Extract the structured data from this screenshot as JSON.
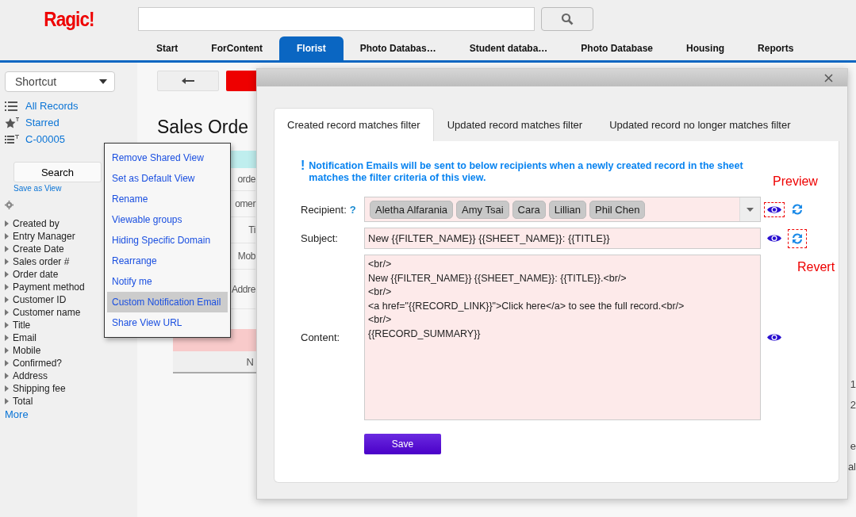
{
  "logo": "Ragic!",
  "tabs": [
    {
      "label": "Start",
      "selected": false
    },
    {
      "label": "ForContent",
      "selected": false
    },
    {
      "label": "Florist",
      "selected": true
    },
    {
      "label": "Photo Databas…",
      "selected": false
    },
    {
      "label": "Student databa…",
      "selected": false
    },
    {
      "label": "Photo Database",
      "selected": false
    },
    {
      "label": "Housing",
      "selected": false
    },
    {
      "label": "Reports",
      "selected": false
    }
  ],
  "sidebar": {
    "shortcut": "Shortcut",
    "views": [
      {
        "label": "All Records",
        "kind": "list"
      },
      {
        "label": "Starred",
        "kind": "star"
      },
      {
        "label": "C-00005",
        "kind": "filter"
      }
    ],
    "search_button": "Search",
    "save_view": "Save as View",
    "fields": [
      "Created by",
      "Entry Manager",
      "Create Date",
      "Sales order #",
      "Order date",
      "Payment method",
      "Customer ID",
      "Customer name",
      "Title",
      "Email",
      "Mobile",
      "Confirmed?",
      "Address",
      "Shipping fee",
      "Total"
    ],
    "more": "More"
  },
  "background": {
    "title": "Sales Orde",
    "field_labels": [
      "orde",
      "omer",
      "Ti",
      "Mob",
      "Addre"
    ],
    "table_header": "N",
    "row_numbers": [
      "1",
      "2"
    ],
    "footer_fragments": [
      "e",
      "al"
    ]
  },
  "context_menu": {
    "items": [
      {
        "label": "Remove Shared View",
        "selected": false
      },
      {
        "label": "Set as Default View",
        "selected": false
      },
      {
        "label": "Rename",
        "selected": false
      },
      {
        "label": "Viewable groups",
        "selected": false
      },
      {
        "label": "Hiding Specific Domain",
        "selected": false
      },
      {
        "label": "Rearrange",
        "selected": false
      },
      {
        "label": "Notify me",
        "selected": false
      },
      {
        "label": "Custom Notification Email",
        "selected": true
      },
      {
        "label": "Share View URL",
        "selected": false
      }
    ]
  },
  "dialog": {
    "tabs": [
      {
        "label": "Created record matches filter",
        "selected": true
      },
      {
        "label": "Updated record matches filter",
        "selected": false
      },
      {
        "label": "Updated record no longer matches filter",
        "selected": false
      }
    ],
    "notice_mark": "!",
    "notice": "Notification Emails will be sent to below recipients when a newly created record in the sheet matches the filter criteria of this view.",
    "recipient_label": "Recipient:",
    "help": "?",
    "recipients": [
      "Aletha Alfarania",
      "Amy Tsai",
      "Cara",
      "Lillian",
      "Phil Chen"
    ],
    "subject_label": "Subject:",
    "subject": "New {{FILTER_NAME}} {{SHEET_NAME}}: {{TITLE}}",
    "content_label": "Content:",
    "content_lines": [
      "<br/>",
      "New {{FILTER_NAME}} {{SHEET_NAME}}: {{TITLE}}.<br/>",
      "<br/>",
      "<a href=\"{{RECORD_LINK}}\">Click here</a> to see the full record.<br/>",
      "<br/>",
      "{{RECORD_SUMMARY}}"
    ],
    "save": "Save",
    "preview_note": "Preview",
    "revert_note": "Revert"
  }
}
